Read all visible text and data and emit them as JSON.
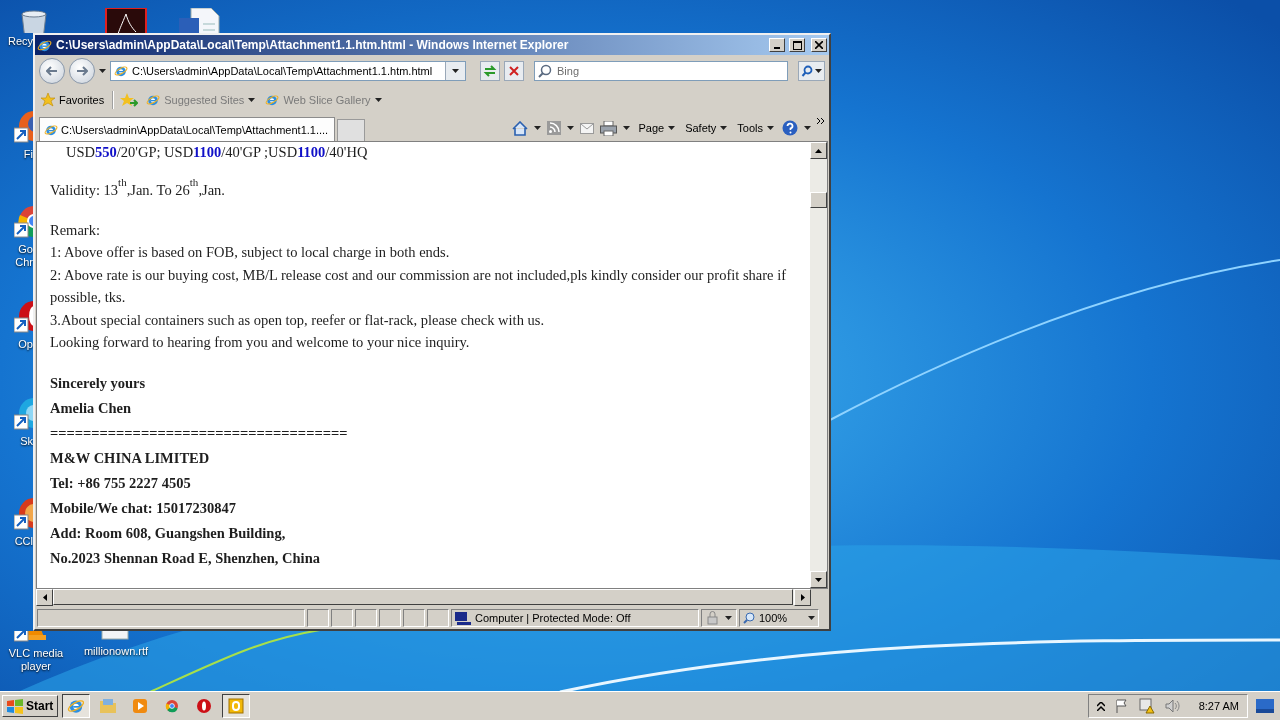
{
  "desktop": {
    "icons": [
      {
        "kind": "recycle-bin",
        "shortcut": false,
        "lines": [
          "Recy"
        ]
      },
      {
        "kind": "pdf",
        "shortcut": false
      },
      {
        "kind": "word",
        "shortcut": false
      },
      {
        "kind": "firefox",
        "shortcut": true,
        "lines": [
          "Fi"
        ]
      },
      {
        "kind": "chrome",
        "shortcut": true,
        "lines": [
          "Go",
          "Chr"
        ]
      },
      {
        "kind": "opera",
        "shortcut": true,
        "lines": [
          "Op"
        ]
      },
      {
        "kind": "skype",
        "shortcut": true,
        "lines": [
          "Sk"
        ]
      },
      {
        "kind": "ccleaner",
        "shortcut": true,
        "lines": [
          "CCl"
        ]
      },
      {
        "kind": "vlc",
        "shortcut": true,
        "lines": [
          "VLC media",
          "player"
        ]
      },
      {
        "kind": "document",
        "shortcut": false,
        "lines": [
          "millionown.rtf"
        ]
      }
    ]
  },
  "window": {
    "title": "C:\\Users\\admin\\AppData\\Local\\Temp\\Attachment1.1.htm.html - Windows Internet Explorer",
    "address": "C:\\Users\\admin\\AppData\\Local\\Temp\\Attachment1.1.htm.html",
    "search": {
      "placeholder": "Bing"
    },
    "favorites_bar": {
      "favorites": "Favorites",
      "links": [
        "Suggested Sites",
        "Web Slice Gallery"
      ]
    },
    "tabs": [
      {
        "label": "C:\\Users\\admin\\AppData\\Local\\Temp\\Attachment1.1....",
        "selected": true
      }
    ],
    "commands": [
      "Page",
      "Safety",
      "Tools"
    ],
    "page": {
      "blocks": [
        {
          "kind": "rates",
          "lines": [
            "USD**550**/20'GP; USD**1100**/40'GP ;USD**1100**/40'HQ"
          ]
        },
        {
          "kind": "plain",
          "lines": [
            "Validity: 13$^{th}$,Jan. To 26$^{th}$,Jan."
          ]
        },
        {
          "kind": "plain",
          "lines": [
            "Remark:",
            "1: Above offer is based on FOB, subject to local charge in both ends.",
            "2: Above rate is our buying cost, MB/L release cost and our commission are not included,pls kindly consider our profit share if possible, tks.",
            "3.About special containers such as open top, reefer or flat-rack, please check with us.",
            "Looking forward to hearing from you and welcome to your nice inquiry."
          ]
        },
        {
          "kind": "signature",
          "lines": [
            "Sincerely yours",
            "Amelia Chen",
            "====================================",
            "M&W CHINA LIMITED",
            "Tel: +86 755 2227 4505",
            "Mobile/We chat: 15017230847",
            "Add: Room 608, Guangshen Building,",
            "No.2023 Shennan Road E, Shenzhen, China"
          ]
        }
      ]
    },
    "status_bar": {
      "zone": "Computer | Protected Mode: Off",
      "zoom": "100%"
    }
  },
  "taskbar": {
    "start": "Start",
    "items": [
      {
        "kind": "ie",
        "selected": true
      },
      {
        "kind": "explorer",
        "selected": false
      },
      {
        "kind": "media-player",
        "selected": false
      },
      {
        "kind": "chrome",
        "selected": false
      },
      {
        "kind": "opera",
        "selected": false
      },
      {
        "kind": "app",
        "selected": true
      }
    ],
    "clock": "8:27 AM"
  }
}
